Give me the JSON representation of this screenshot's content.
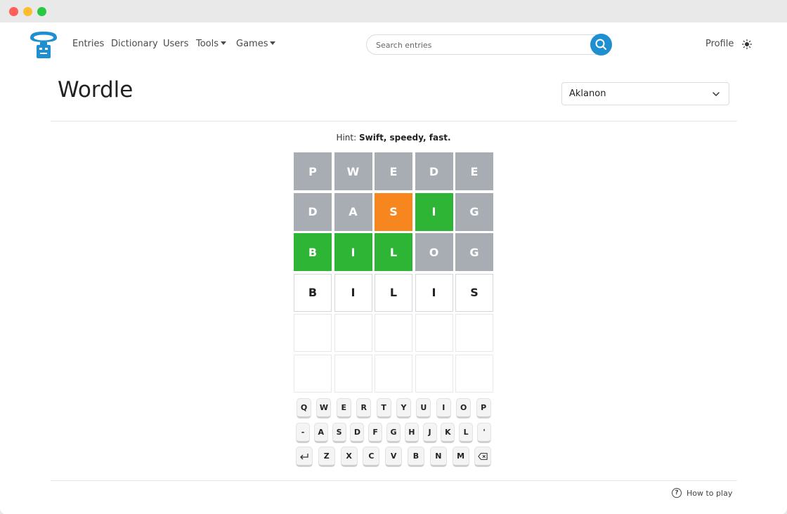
{
  "nav": {
    "links": [
      "Entries",
      "Dictionary",
      "Users",
      "Tools",
      "Games"
    ],
    "search_placeholder": "Search entries",
    "profile": "Profile"
  },
  "page": {
    "title": "Wordle",
    "language_select": "Aklanon"
  },
  "game": {
    "hint_label": "Hint:",
    "hint_text": "Swift, speedy, fast.",
    "rows": [
      [
        {
          "l": "P",
          "s": "absent"
        },
        {
          "l": "W",
          "s": "absent"
        },
        {
          "l": "E",
          "s": "absent"
        },
        {
          "l": "D",
          "s": "absent"
        },
        {
          "l": "E",
          "s": "absent"
        }
      ],
      [
        {
          "l": "D",
          "s": "absent"
        },
        {
          "l": "A",
          "s": "absent"
        },
        {
          "l": "S",
          "s": "present"
        },
        {
          "l": "I",
          "s": "correct"
        },
        {
          "l": "G",
          "s": "absent"
        }
      ],
      [
        {
          "l": "B",
          "s": "correct"
        },
        {
          "l": "I",
          "s": "correct"
        },
        {
          "l": "L",
          "s": "correct"
        },
        {
          "l": "O",
          "s": "absent"
        },
        {
          "l": "G",
          "s": "absent"
        }
      ],
      [
        {
          "l": "B",
          "s": "typed"
        },
        {
          "l": "I",
          "s": "typed"
        },
        {
          "l": "L",
          "s": "typed"
        },
        {
          "l": "I",
          "s": "typed"
        },
        {
          "l": "S",
          "s": "typed"
        }
      ],
      [
        {
          "l": "",
          "s": "empty"
        },
        {
          "l": "",
          "s": "empty"
        },
        {
          "l": "",
          "s": "empty"
        },
        {
          "l": "",
          "s": "empty"
        },
        {
          "l": "",
          "s": "empty"
        }
      ],
      [
        {
          "l": "",
          "s": "empty"
        },
        {
          "l": "",
          "s": "empty"
        },
        {
          "l": "",
          "s": "empty"
        },
        {
          "l": "",
          "s": "empty"
        },
        {
          "l": "",
          "s": "empty"
        }
      ]
    ],
    "colors": {
      "absent": "#a7adb3",
      "present": "#f7861e",
      "correct": "#2fb535"
    }
  },
  "keyboard": {
    "row1": [
      "Q",
      "W",
      "E",
      "R",
      "T",
      "Y",
      "U",
      "I",
      "O",
      "P"
    ],
    "row2": [
      "-",
      "A",
      "S",
      "D",
      "F",
      "G",
      "H",
      "J",
      "K",
      "L",
      "'"
    ],
    "row3": [
      "enter-icon",
      "Z",
      "X",
      "C",
      "V",
      "B",
      "N",
      "M",
      "backspace-icon"
    ]
  },
  "footer": {
    "how_to_play": "How to play",
    "help_icon": "?"
  }
}
